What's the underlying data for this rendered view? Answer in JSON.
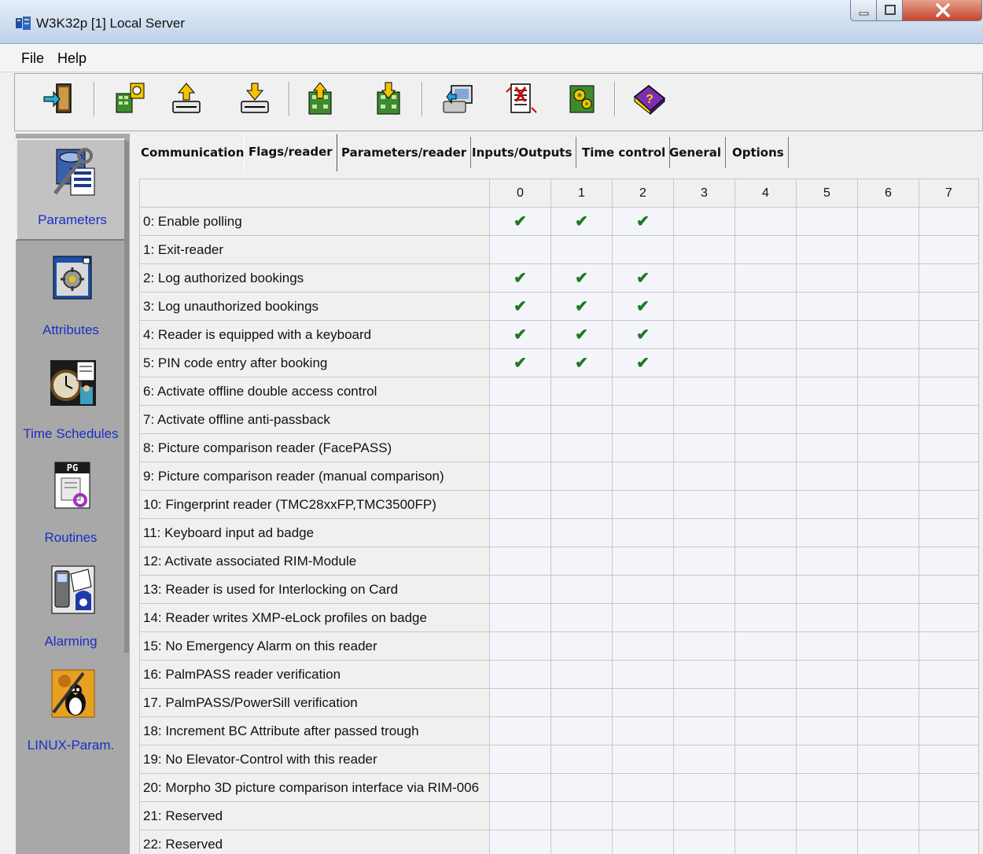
{
  "window": {
    "title": "W3K32p [1] Local Server",
    "app_icon": "server-app-icon"
  },
  "menu": {
    "items": [
      "File",
      "Help"
    ]
  },
  "toolbar": {
    "buttons": [
      {
        "name": "exit-door-icon"
      },
      {
        "name": "load-reader-icon"
      },
      {
        "name": "upload-icon"
      },
      {
        "name": "download-icon"
      },
      {
        "name": "upload-all-icon"
      },
      {
        "name": "download-all-icon"
      },
      {
        "name": "transfer-icon"
      },
      {
        "name": "compare-document-icon"
      },
      {
        "name": "reader-config-icon"
      },
      {
        "name": "help-book-icon"
      }
    ]
  },
  "sidebar": {
    "items": [
      {
        "label": "Parameters",
        "icon": "parameters-icon",
        "active": true
      },
      {
        "label": "Attributes",
        "icon": "attributes-icon"
      },
      {
        "label": "Time Schedules",
        "icon": "clock-icon"
      },
      {
        "label": "Routines",
        "icon": "routines-icon"
      },
      {
        "label": "Alarming",
        "icon": "alarm-icon"
      },
      {
        "label": "LINUX-Param.",
        "icon": "linux-penguin-icon"
      }
    ]
  },
  "tabs": [
    {
      "label": "Communication"
    },
    {
      "label": "Flags/reader",
      "active": true
    },
    {
      "label": "Parameters/reader"
    },
    {
      "label": "Inputs/Outputs"
    },
    {
      "label": "Time control"
    },
    {
      "label": "General"
    },
    {
      "label": "Options"
    }
  ],
  "grid": {
    "columns": [
      "0",
      "1",
      "2",
      "3",
      "4",
      "5",
      "6",
      "7"
    ],
    "check_symbol": "✔",
    "rows": [
      {
        "label": "0: Enable polling",
        "checks": [
          true,
          true,
          true,
          false,
          false,
          false,
          false,
          false
        ]
      },
      {
        "label": "1: Exit-reader",
        "checks": [
          false,
          false,
          false,
          false,
          false,
          false,
          false,
          false
        ]
      },
      {
        "label": "2: Log authorized bookings",
        "checks": [
          true,
          true,
          true,
          false,
          false,
          false,
          false,
          false
        ]
      },
      {
        "label": "3: Log unauthorized bookings",
        "checks": [
          true,
          true,
          true,
          false,
          false,
          false,
          false,
          false
        ]
      },
      {
        "label": "4: Reader is equipped with a keyboard",
        "checks": [
          true,
          true,
          true,
          false,
          false,
          false,
          false,
          false
        ]
      },
      {
        "label": "5: PIN code entry after booking",
        "checks": [
          true,
          true,
          true,
          false,
          false,
          false,
          false,
          false
        ]
      },
      {
        "label": "6: Activate offline double access control",
        "checks": [
          false,
          false,
          false,
          false,
          false,
          false,
          false,
          false
        ]
      },
      {
        "label": "7: Activate offline anti-passback",
        "checks": [
          false,
          false,
          false,
          false,
          false,
          false,
          false,
          false
        ]
      },
      {
        "label": "8: Picture comparison reader (FacePASS)",
        "checks": [
          false,
          false,
          false,
          false,
          false,
          false,
          false,
          false
        ]
      },
      {
        "label": "9: Picture comparison reader (manual comparison)",
        "checks": [
          false,
          false,
          false,
          false,
          false,
          false,
          false,
          false
        ]
      },
      {
        "label": "10: Fingerprint reader (TMC28xxFP,TMC3500FP)",
        "checks": [
          false,
          false,
          false,
          false,
          false,
          false,
          false,
          false
        ]
      },
      {
        "label": "11: Keyboard input ad badge",
        "checks": [
          false,
          false,
          false,
          false,
          false,
          false,
          false,
          false
        ]
      },
      {
        "label": "12: Activate associated RIM-Module",
        "checks": [
          false,
          false,
          false,
          false,
          false,
          false,
          false,
          false
        ]
      },
      {
        "label": "13: Reader is used for Interlocking on Card",
        "checks": [
          false,
          false,
          false,
          false,
          false,
          false,
          false,
          false
        ]
      },
      {
        "label": "14: Reader writes XMP-eLock profiles on badge",
        "checks": [
          false,
          false,
          false,
          false,
          false,
          false,
          false,
          false
        ]
      },
      {
        "label": "15: No Emergency Alarm on this reader",
        "checks": [
          false,
          false,
          false,
          false,
          false,
          false,
          false,
          false
        ]
      },
      {
        "label": "16: PalmPASS reader verification",
        "checks": [
          false,
          false,
          false,
          false,
          false,
          false,
          false,
          false
        ]
      },
      {
        "label": "17. PalmPASS/PowerSill verification",
        "checks": [
          false,
          false,
          false,
          false,
          false,
          false,
          false,
          false
        ]
      },
      {
        "label": "18: Increment BC Attribute after passed trough",
        "checks": [
          false,
          false,
          false,
          false,
          false,
          false,
          false,
          false
        ]
      },
      {
        "label": "19: No Elevator-Control with this reader",
        "checks": [
          false,
          false,
          false,
          false,
          false,
          false,
          false,
          false
        ]
      },
      {
        "label": "20: Morpho 3D picture comparison interface via RIM-006",
        "checks": [
          false,
          false,
          false,
          false,
          false,
          false,
          false,
          false
        ]
      },
      {
        "label": "21: Reserved",
        "checks": [
          false,
          false,
          false,
          false,
          false,
          false,
          false,
          false
        ]
      },
      {
        "label": "22: Reserved",
        "checks": [
          false,
          false,
          false,
          false,
          false,
          false,
          false,
          false
        ]
      }
    ]
  },
  "colors": {
    "check": "#1d7a1d",
    "sidebar_label": "#1c2fc4",
    "sidebar_bg": "#a8a8a8"
  }
}
